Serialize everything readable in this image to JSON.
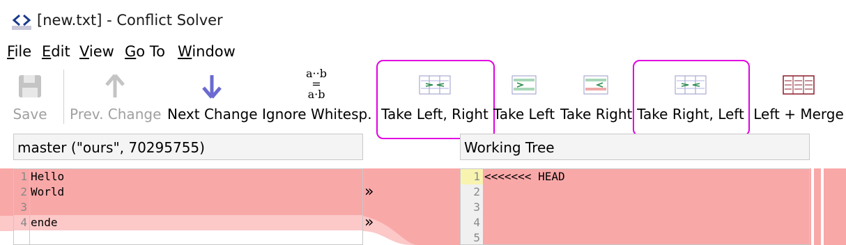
{
  "window": {
    "title": "[new.txt] - Conflict Solver"
  },
  "menu": {
    "items": [
      {
        "label": "File",
        "key": "F",
        "rest": "ile"
      },
      {
        "label": "Edit",
        "key": "E",
        "rest": "dit"
      },
      {
        "label": "View",
        "key": "V",
        "rest": "iew"
      },
      {
        "label": "Go To",
        "key": "G",
        "rest": "o To"
      },
      {
        "label": "Window",
        "key": "W",
        "rest": "indow"
      }
    ]
  },
  "toolbar": {
    "save": "Save",
    "prev_change": "Prev. Change",
    "next_change": "Next Change",
    "ignore_whitespace": "Ignore Whitesp.",
    "ignore_icon_top": "a··b",
    "ignore_icon_mid": "=",
    "ignore_icon_bot": "a·b",
    "take_left_right": "Take Left, Right",
    "take_left": "Take Left",
    "take_right": "Take Right",
    "take_right_left": "Take Right, Left",
    "left_merge": "Left + Merge"
  },
  "left_pane": {
    "title": "master (\"ours\", 70295755)",
    "lines": [
      {
        "num": "1",
        "text": "Hello"
      },
      {
        "num": "2",
        "text": "World"
      },
      {
        "num": "3",
        "text": ""
      },
      {
        "num": "4",
        "text": "ende"
      }
    ],
    "arrow": "»"
  },
  "right_pane": {
    "title": "Working Tree",
    "lines": [
      {
        "num": "1",
        "text": "<<<<<<< HEAD"
      },
      {
        "num": "2",
        "text": ""
      },
      {
        "num": "3",
        "text": ""
      },
      {
        "num": "4",
        "text": ""
      },
      {
        "num": "5",
        "text": ""
      }
    ]
  },
  "colors": {
    "conflict": "#f9a8a8",
    "conflict_light": "#fcc8c8",
    "highlight": "#e000e0",
    "current_line": "#f8f4b0"
  }
}
